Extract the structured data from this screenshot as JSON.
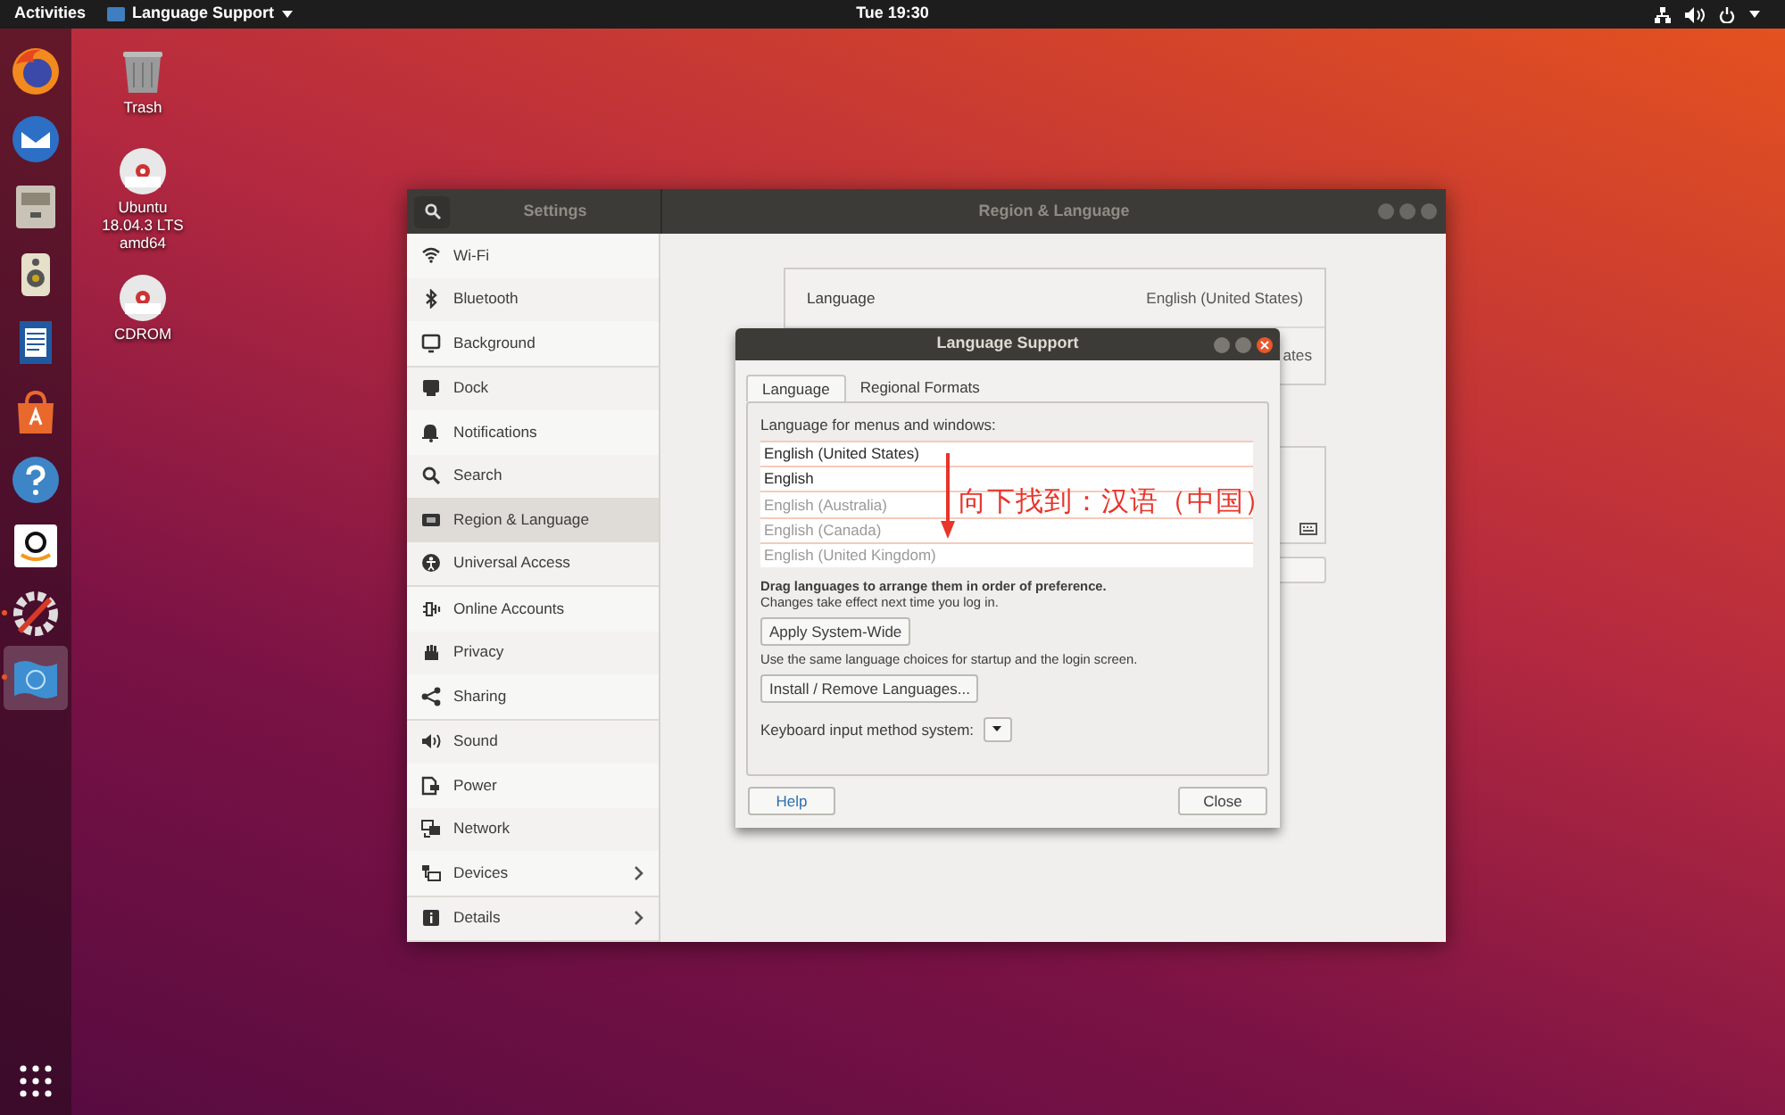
{
  "top_bar": {
    "activities": "Activities",
    "app_menu": "Language Support",
    "clock": "Tue 19:30"
  },
  "dock": {
    "items": [
      {
        "running": false,
        "selected": false
      },
      {
        "running": false,
        "selected": false
      },
      {
        "running": false,
        "selected": false
      },
      {
        "running": false,
        "selected": false
      },
      {
        "running": false,
        "selected": false
      },
      {
        "running": false,
        "selected": false
      },
      {
        "running": false,
        "selected": false
      },
      {
        "running": false,
        "selected": false
      },
      {
        "running": true,
        "selected": false
      },
      {
        "running": true,
        "selected": true
      }
    ]
  },
  "desktop_icons": [
    {
      "label": "Trash"
    },
    {
      "label": "Ubuntu 18.04.3 LTS amd64"
    },
    {
      "label": "CDROM"
    }
  ],
  "settings_window": {
    "title": "Settings",
    "panel_title": "Region & Language",
    "sidebar": {
      "groups": [
        [
          {
            "label": "Wi-Fi",
            "selected": false,
            "has_arrow": false
          },
          {
            "label": "Bluetooth",
            "selected": false,
            "has_arrow": false
          },
          {
            "label": "Background",
            "selected": false,
            "has_arrow": false
          }
        ],
        [
          {
            "label": "Dock",
            "selected": false,
            "has_arrow": false
          },
          {
            "label": "Notifications",
            "selected": false,
            "has_arrow": false
          },
          {
            "label": "Search",
            "selected": false,
            "has_arrow": false
          },
          {
            "label": "Region & Language",
            "selected": true,
            "has_arrow": false
          },
          {
            "label": "Universal Access",
            "selected": false,
            "has_arrow": false
          }
        ],
        [
          {
            "label": "Online Accounts",
            "selected": false,
            "has_arrow": false
          },
          {
            "label": "Privacy",
            "selected": false,
            "has_arrow": false
          },
          {
            "label": "Sharing",
            "selected": false,
            "has_arrow": false
          }
        ],
        [
          {
            "label": "Sound",
            "selected": false,
            "has_arrow": false
          },
          {
            "label": "Power",
            "selected": false,
            "has_arrow": false
          },
          {
            "label": "Network",
            "selected": false,
            "has_arrow": false
          },
          {
            "label": "Devices",
            "selected": false,
            "has_arrow": true
          }
        ],
        [
          {
            "label": "Details",
            "selected": false,
            "has_arrow": true
          }
        ]
      ]
    },
    "rows": [
      {
        "label": "Language",
        "value": "English (United States)"
      },
      {
        "value": "ates"
      }
    ]
  },
  "dialog": {
    "title": "Language Support",
    "tabs": [
      {
        "label": "Language",
        "selected": true
      },
      {
        "label": "Regional Formats",
        "selected": false
      }
    ],
    "list_label": "Language for menus and windows:",
    "languages": [
      {
        "label": "English (United States)",
        "disabled": false
      },
      {
        "label": "English",
        "disabled": false
      },
      {
        "label": "English (Australia)",
        "disabled": true
      },
      {
        "label": "English (Canada)",
        "disabled": true
      },
      {
        "label": "English (United Kingdom)",
        "disabled": true
      }
    ],
    "drag_hint": "Drag languages to arrange them in order of preference.",
    "drag_note": "Changes take effect next time you log in.",
    "apply_button": "Apply System-Wide",
    "apply_note": "Use the same language choices for startup and the login screen.",
    "install_button": "Install / Remove Languages...",
    "keyboard_label": "Keyboard input method system:",
    "help_button": "Help",
    "close_button": "Close"
  },
  "annotation": {
    "text": "向下找到：汉语（中国）"
  }
}
